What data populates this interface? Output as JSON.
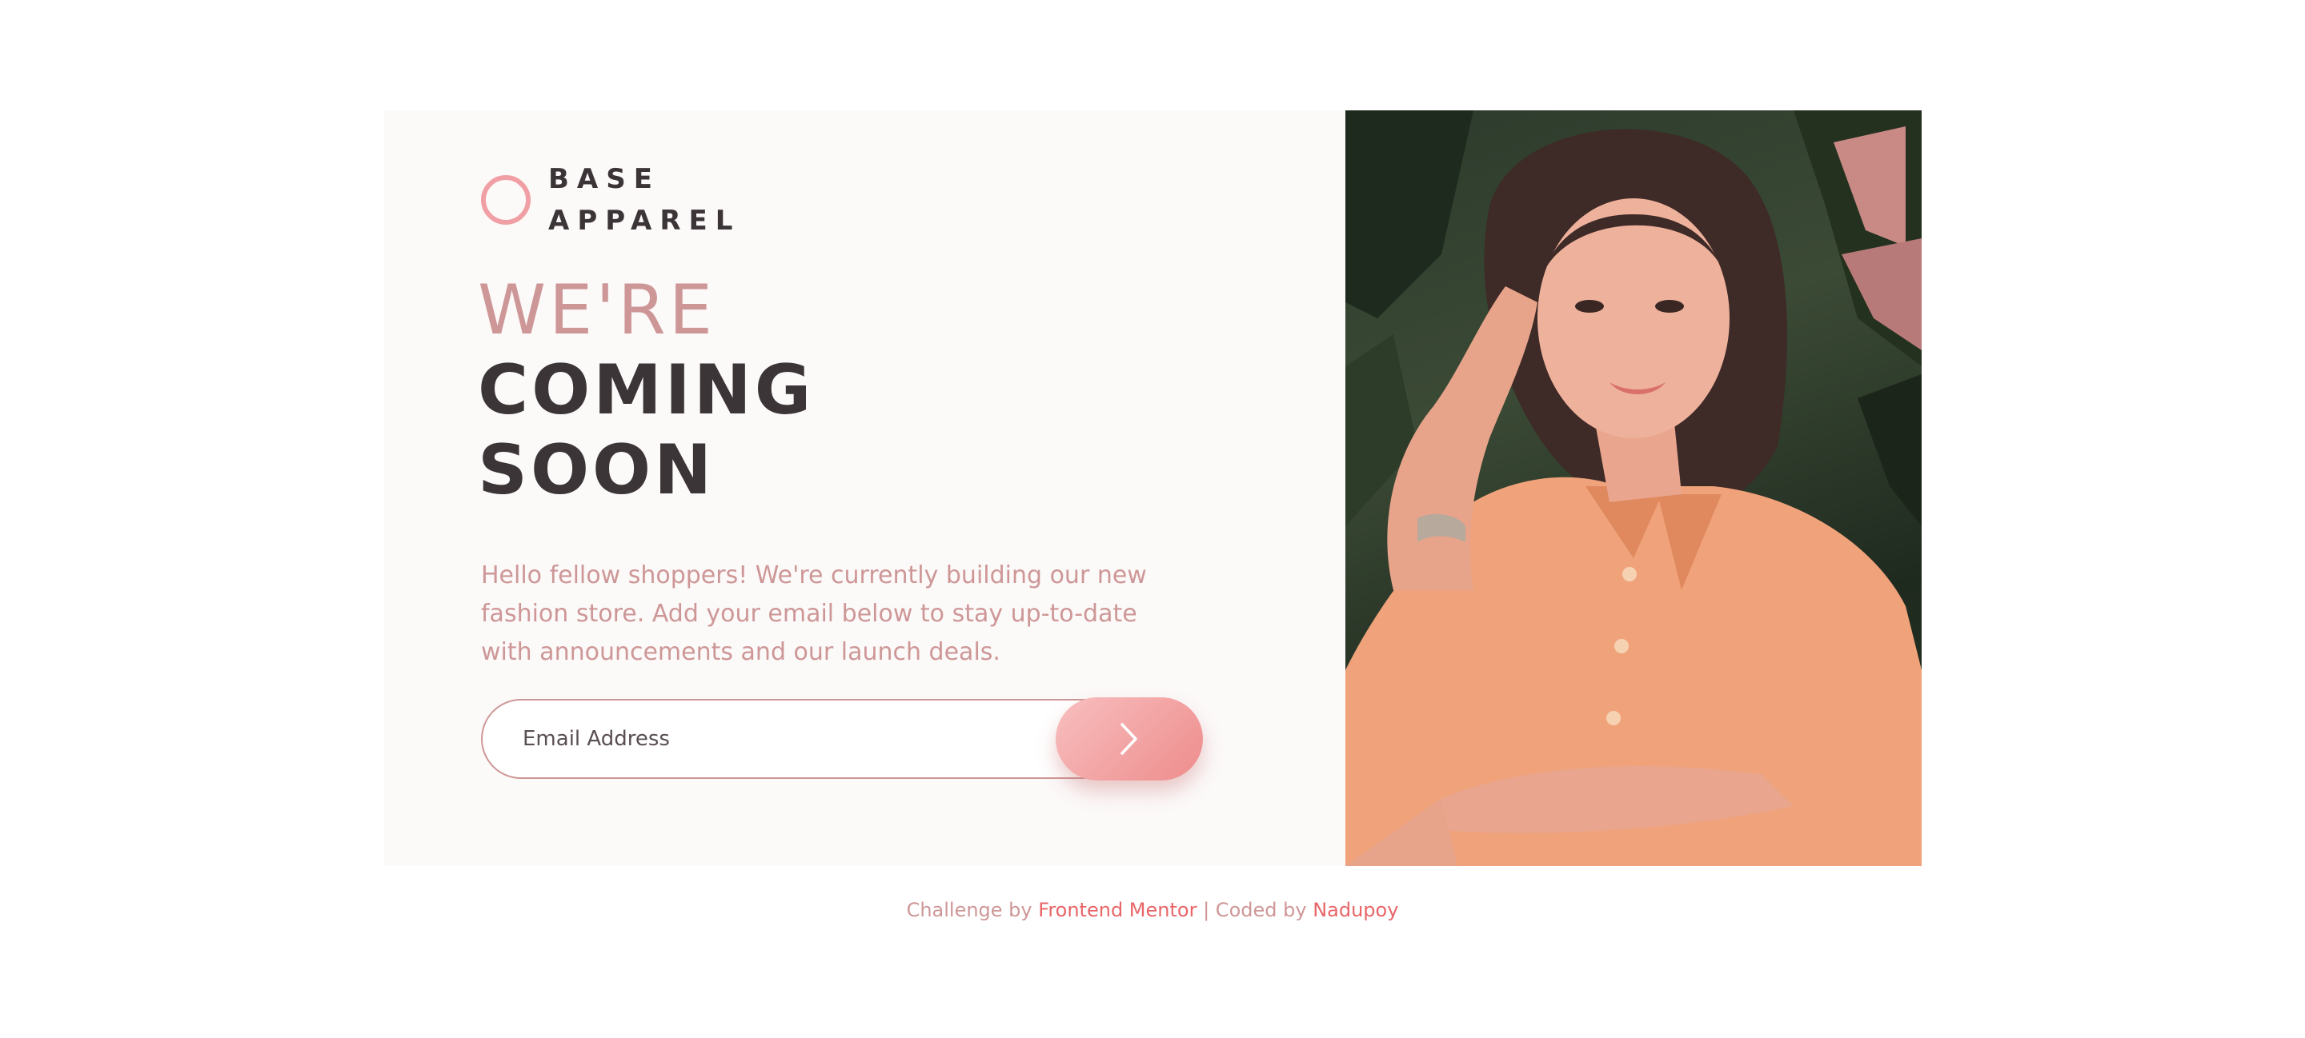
{
  "brand": {
    "line1": "BASE",
    "line2": "APPAREL",
    "ring_color": "#f0a0a4"
  },
  "headline": {
    "light": "WE'RE",
    "bold_line1": "COMING",
    "bold_line2": "SOON"
  },
  "intro": "Hello fellow shoppers! We're currently building our new fashion store. Add your email below to stay up-to-date with announcements and our launch deals.",
  "form": {
    "email_placeholder": "Email Address",
    "submit_icon": "chevron-right-icon"
  },
  "hero_image": {
    "description": "Woman in orange shirt",
    "icon": "hero-photo"
  },
  "footer": {
    "prefix": "Challenge by",
    "link1": "Frontend Mentor",
    "separator": "| Coded by",
    "link2": "Nadupoy"
  },
  "colors": {
    "primary_text": "#3c3537",
    "accent": "#ce9797",
    "link": "#e86568",
    "left_bg": "#fcf9f9"
  }
}
